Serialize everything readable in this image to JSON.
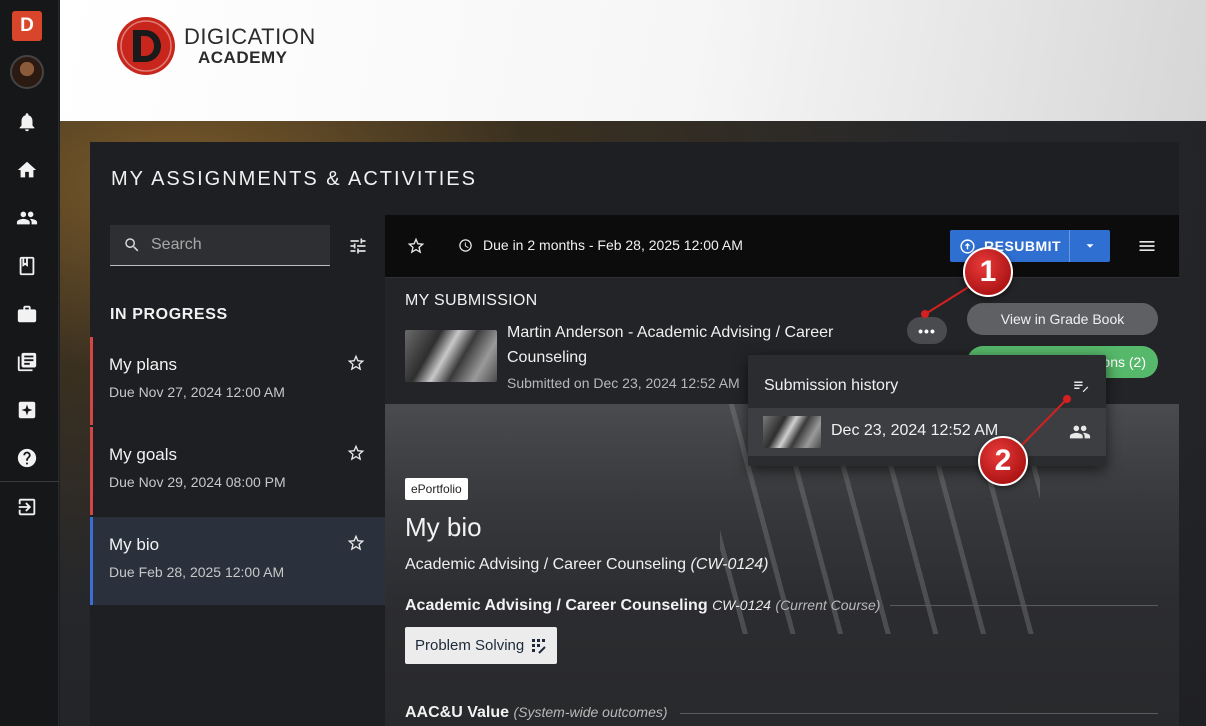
{
  "sidebar": {
    "brand_letter": "D",
    "icons": [
      "bell-icon",
      "home-icon",
      "people-icon",
      "book-icon",
      "briefcase-icon",
      "library-icon",
      "sparkle-icon",
      "help-icon",
      "exit-icon"
    ]
  },
  "header": {
    "logo_line1": "DIGICATION",
    "logo_line2": "ACADEMY"
  },
  "page": {
    "title": "MY ASSIGNMENTS & ACTIVITIES",
    "search_placeholder": "Search",
    "section_label": "IN PROGRESS",
    "items": [
      {
        "title": "My plans",
        "due": "Due Nov 27, 2024 12:00 AM",
        "status_color": "#d64545"
      },
      {
        "title": "My goals",
        "due": "Due Nov 29, 2024 08:00 PM",
        "status_color": "#d64545"
      },
      {
        "title": "My bio",
        "due": "Due Feb 28, 2025 12:00 AM",
        "status_color": "#3b6fd4"
      }
    ]
  },
  "assignment": {
    "due_text": "Due in 2 months - Feb 28, 2025 12:00 AM",
    "resubmit_label": "RESUBMIT",
    "submission_heading": "MY SUBMISSION",
    "submission_title": "Martin Anderson - Academic Advising / Career Counseling",
    "submitted_on": "Submitted on Dec 23, 2024 12:52 AM",
    "more_label": "•••",
    "gradebook_label": "View in Grade Book",
    "green_button_partial": "ons (2)",
    "history_title": "Submission history",
    "history_entry": "Dec 23, 2024 12:52 AM",
    "tag": "ePortfolio",
    "bio_title": "My bio",
    "course_name": "Academic Advising / Career Counseling",
    "course_code": "(CW-0124)",
    "section1_title": "Academic Advising / Career Counseling",
    "section1_code": "CW-0124",
    "section1_note": "(Current Course)",
    "chip_label": "Problem Solving",
    "section2_title": "AAC&U Value",
    "section2_note": "(System-wide outcomes)"
  },
  "callouts": {
    "one": "1",
    "two": "2"
  },
  "colors": {
    "accent_blue": "#2f6fd1",
    "success_green": "#56b86a",
    "brand_red": "#d9452a"
  }
}
